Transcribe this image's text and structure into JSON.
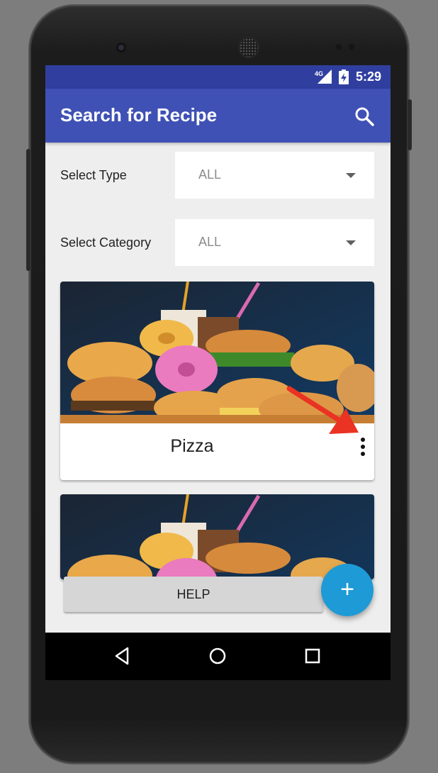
{
  "status_bar": {
    "network": "4G",
    "time": "5:29"
  },
  "app_bar": {
    "title": "Search for Recipe",
    "search_icon": "search-icon"
  },
  "filters": [
    {
      "label": "Select Type",
      "value": "ALL"
    },
    {
      "label": "Select Category",
      "value": "ALL"
    }
  ],
  "recipes": [
    {
      "title": "Pizza",
      "image": "fast-food-photo",
      "menu_icon": "more-vert-icon"
    },
    {
      "title": "",
      "image": "fast-food-photo"
    }
  ],
  "help_label": "HELP",
  "fab_label": "+",
  "colors": {
    "primary": "#3f51b5",
    "primary_dark": "#303f9f",
    "accent": "#1e9ad6",
    "annotation_arrow": "#ea3323"
  },
  "nav_bar": [
    "back-icon",
    "home-icon",
    "recents-icon"
  ]
}
